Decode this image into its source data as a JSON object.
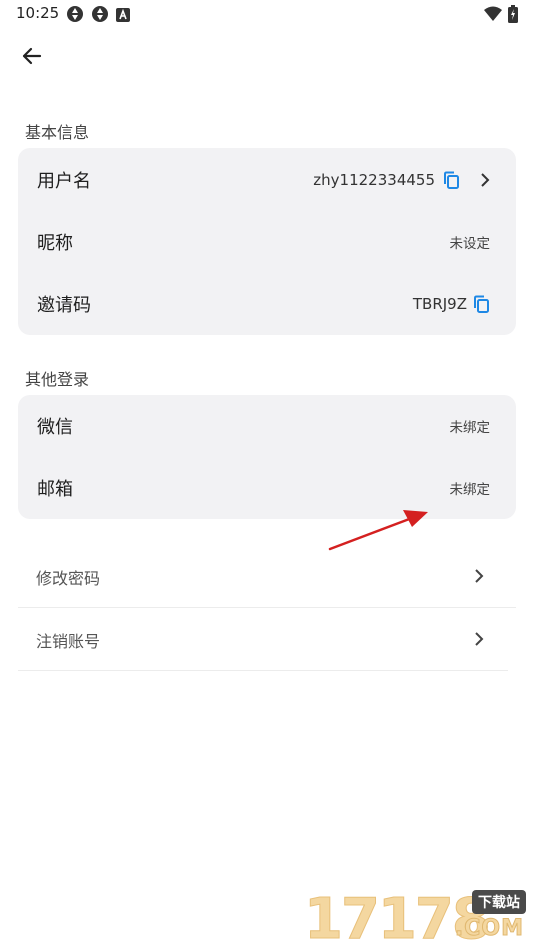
{
  "status_bar": {
    "time": "10:25",
    "icons_left": [
      "sync-icon",
      "sync-icon",
      "font-icon"
    ],
    "icons_right": [
      "wifi-icon",
      "battery-icon"
    ]
  },
  "header": {
    "back_icon": "arrow-back-icon"
  },
  "basic_info": {
    "title": "基本信息",
    "rows": [
      {
        "label": "用户名",
        "value": "zhy1122334455"
      },
      {
        "label": "昵称",
        "value": "未设定"
      },
      {
        "label": "邀请码",
        "value": "TBRJ9Z"
      }
    ]
  },
  "other_login": {
    "title": "其他登录",
    "rows": [
      {
        "label": "微信",
        "value": "未绑定"
      },
      {
        "label": "邮箱",
        "value": "未绑定"
      }
    ]
  },
  "actions": [
    {
      "label": "修改密码"
    },
    {
      "label": "注销账号"
    }
  ],
  "colors": {
    "accent": "#1e88e5",
    "card_bg": "#f2f2f4",
    "annotation": "#d42020"
  },
  "watermark": {
    "number": "17178",
    "tag": "下载站",
    "suffix": ".COM"
  }
}
